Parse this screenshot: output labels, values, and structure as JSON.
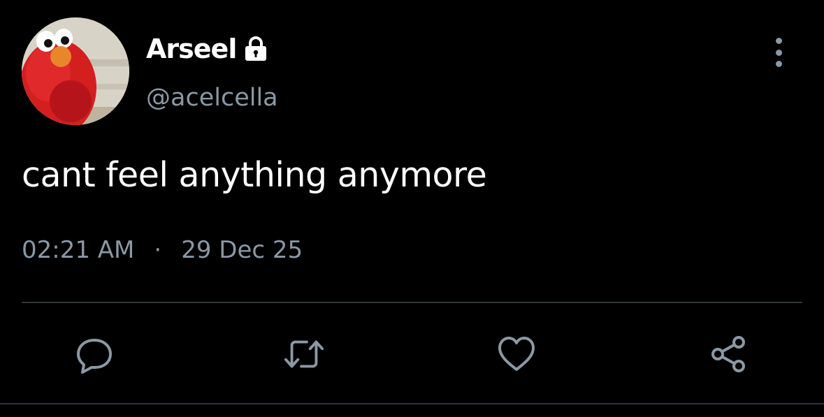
{
  "user": {
    "display_name": "Arseel",
    "handle": "@acelcella",
    "protected_icon": "lock-icon",
    "avatar": "avatar"
  },
  "tweet": {
    "text": "cant feel anything anymore",
    "time": "02:21 AM",
    "separator": "·",
    "date": "29 Dec 25"
  },
  "actions": {
    "icons": [
      "reply-icon",
      "retweet-icon",
      "like-icon",
      "share-icon"
    ],
    "more_icon": "more-vertical-icon"
  },
  "colors": {
    "background": "#000000",
    "text_primary": "#ffffff",
    "text_secondary": "#8b98a5",
    "divider": "#2f3336"
  }
}
